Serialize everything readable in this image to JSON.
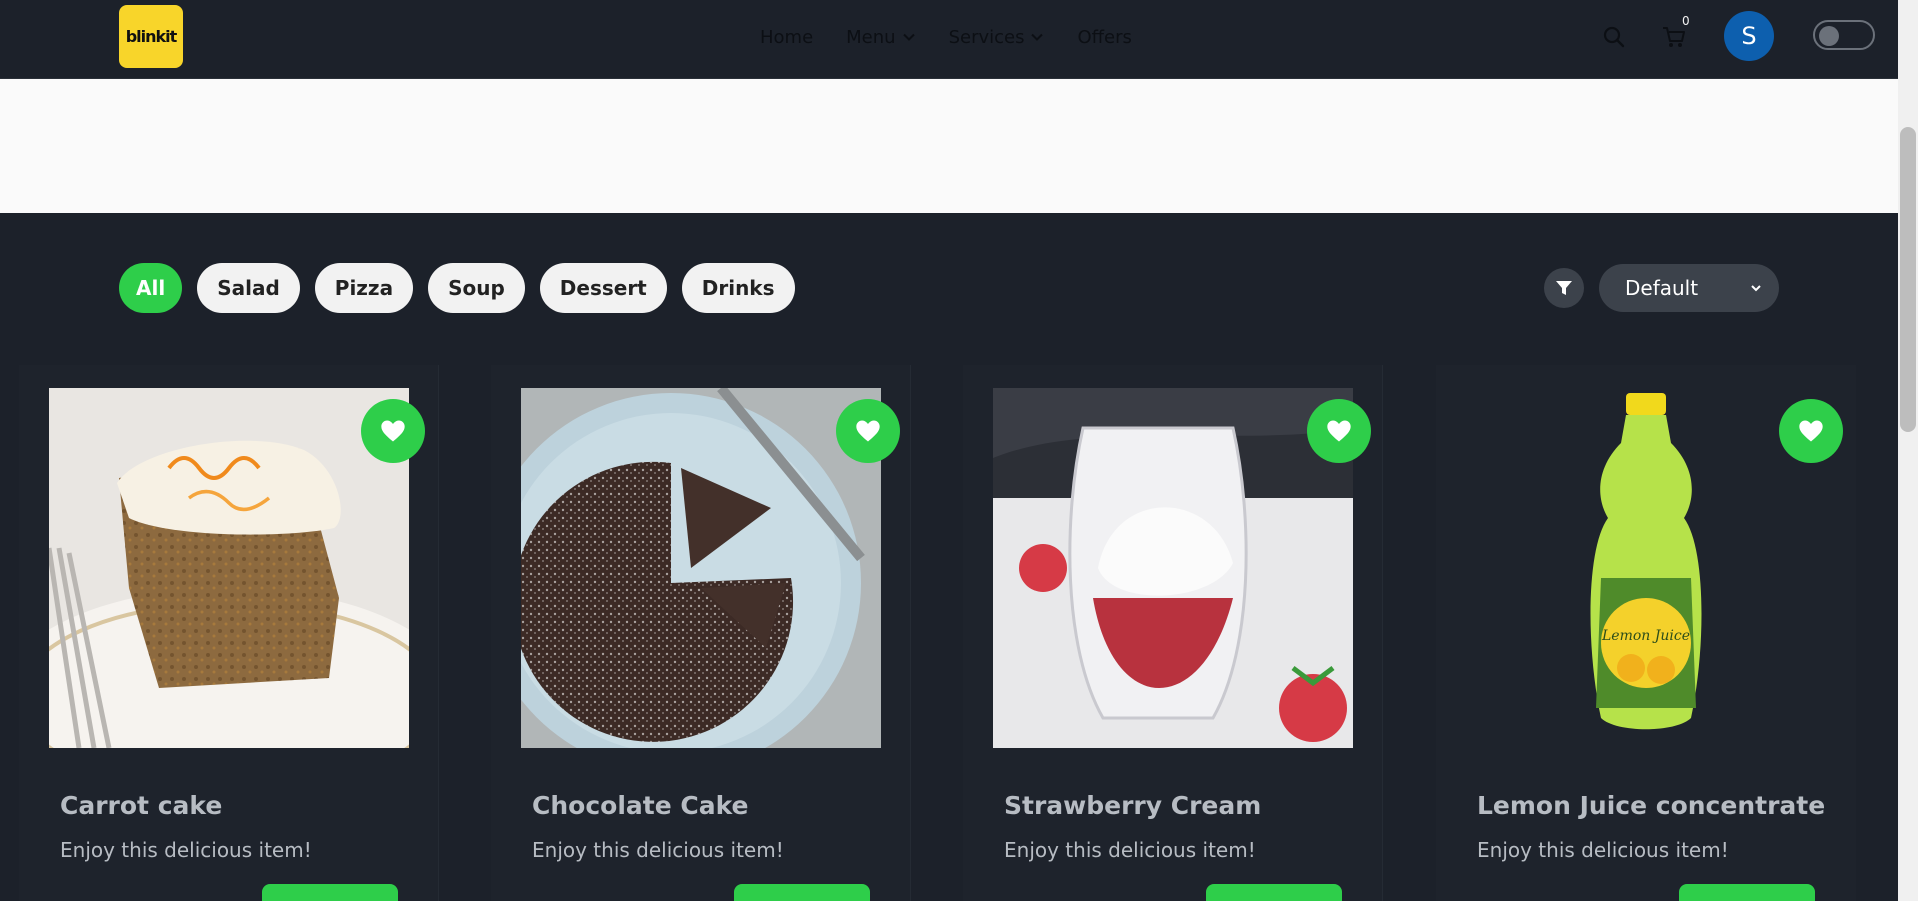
{
  "header": {
    "logo_text_a": "blink",
    "logo_text_b": "it",
    "nav": [
      {
        "label": "Home",
        "has_dropdown": false
      },
      {
        "label": "Menu",
        "has_dropdown": true
      },
      {
        "label": "Services",
        "has_dropdown": true
      },
      {
        "label": "Offers",
        "has_dropdown": false
      }
    ],
    "cart_count": "0",
    "avatar_initial": "S",
    "theme_toggle_on": false
  },
  "filters": {
    "categories": [
      {
        "label": "All",
        "active": true
      },
      {
        "label": "Salad",
        "active": false
      },
      {
        "label": "Pizza",
        "active": false
      },
      {
        "label": "Soup",
        "active": false
      },
      {
        "label": "Dessert",
        "active": false
      },
      {
        "label": "Drinks",
        "active": false
      }
    ],
    "sort_selected": "Default"
  },
  "products": [
    {
      "title": "Carrot cake",
      "description": "Enjoy this delicious item!",
      "image_icon": "carrot-cake-image"
    },
    {
      "title": "Chocolate Cake",
      "description": "Enjoy this delicious item!",
      "image_icon": "chocolate-cake-image"
    },
    {
      "title": "Strawberry Cream",
      "description": "Enjoy this delicious item!",
      "image_icon": "strawberry-cream-image"
    },
    {
      "title": "Lemon Juice concentrate",
      "description": "Enjoy this delicious item!",
      "image_icon": "lemon-juice-image"
    }
  ],
  "colors": {
    "accent": "#2ece4a",
    "background": "#1c212a",
    "logo_bg": "#f8d52a",
    "avatar_bg": "#0d5fae"
  }
}
